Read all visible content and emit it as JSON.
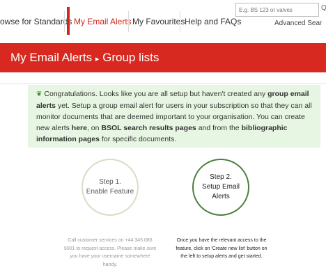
{
  "nav": {
    "items": [
      {
        "label": "owse for Standards",
        "active": false
      },
      {
        "label": "My Email Alerts",
        "active": true
      },
      {
        "label": "My Favourites",
        "active": false
      },
      {
        "label": "Help and FAQs",
        "active": false
      }
    ],
    "search_placeholder": "E.g. BS 123 or valves",
    "advanced_search": "Advanced Sear"
  },
  "header": {
    "title_main": "My Email Alerts",
    "separator": "▸",
    "title_sub": "Group lists"
  },
  "info": {
    "p1": "Congratulations. Looks like you are all setup but haven't created any ",
    "b1": "group email alerts",
    "p2": " yet. Setup a group email alert for users in your subscription so that they can all monitor documents that are deemed important to your organisation. You can create new alerts ",
    "b2": "here",
    "p3": ", on ",
    "b3": "BSOL search results pages",
    "p4": " and from the ",
    "b4": "bibliographic information pages",
    "p5": " for specific documents."
  },
  "steps": [
    {
      "circle_line1": "Step 1.",
      "circle_line2": "Enable Feature",
      "desc": "Call customer services on +44 345 086 9001 to request access. Please make sure you have your username somewhere handy."
    },
    {
      "circle_line1": "Step 2.",
      "circle_line2": "Setup Email Alerts",
      "desc": "Once you have the relevant access to the feature, click on 'Create new list' button on the left to setup alerts and get started."
    }
  ],
  "colors": {
    "brand_red": "#d7291f",
    "info_bg": "#e7f5e3",
    "step_active": "#4a7f3a",
    "step_inactive": "#d8ddc3"
  }
}
